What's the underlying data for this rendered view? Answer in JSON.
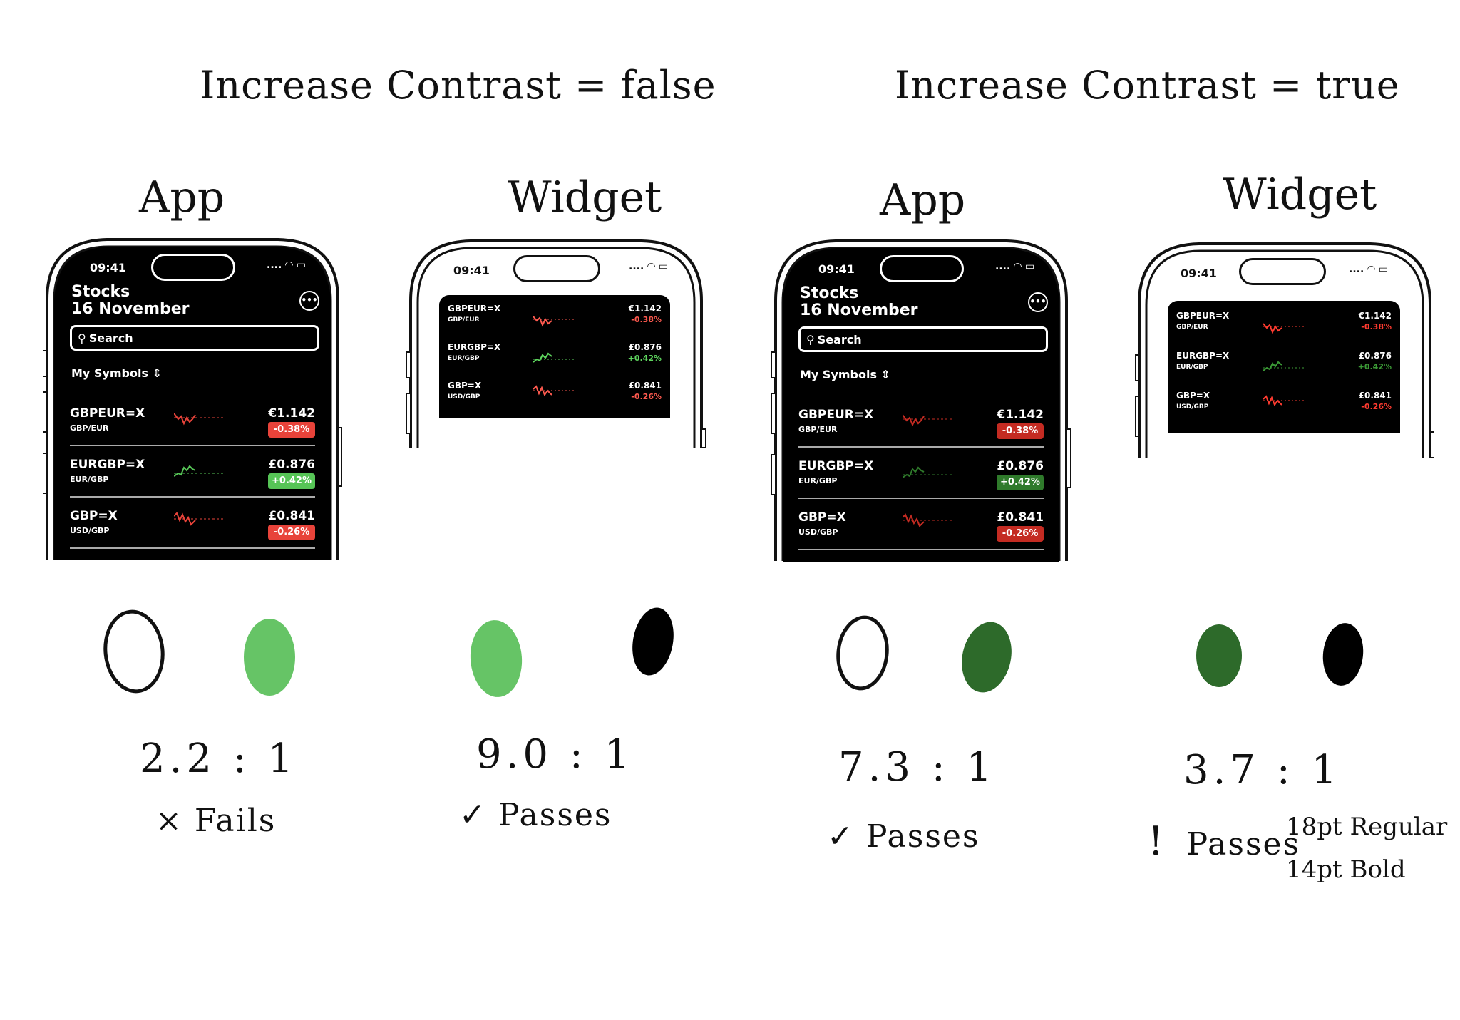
{
  "headings": {
    "left": "Increase Contrast = false",
    "right": "Increase Contrast = true"
  },
  "panels": [
    {
      "label": "App",
      "ratio": "2.2 : 1",
      "verdict_mark": "×",
      "verdict": "Fails",
      "swatch_a": "#ffffff",
      "swatch_b": "#66c466"
    },
    {
      "label": "Widget",
      "ratio": "9.0 : 1",
      "verdict_mark": "✓",
      "verdict": "Passes",
      "swatch_a": "#66c466",
      "swatch_b": "#000000"
    },
    {
      "label": "App",
      "ratio": "7.3 : 1",
      "verdict_mark": "✓",
      "verdict": "Passes",
      "swatch_a": "#ffffff",
      "swatch_b": "#2d6a2a"
    },
    {
      "label": "Widget",
      "ratio": "3.7 : 1",
      "verdict_mark": "!",
      "verdict": "Passes",
      "note_line1": "18pt Regular",
      "note_line2": "14pt Bold",
      "swatch_a": "#2d6a2a",
      "swatch_b": "#000000"
    }
  ],
  "phone": {
    "time": "09:41",
    "signal": ".... ",
    "app_title": "Stocks",
    "app_date": "16 November",
    "menu_icon": "•••",
    "search_placeholder": "Search",
    "my_symbols": "My Symbols ⇕",
    "stocks": [
      {
        "symbol": "GBPEUR=X",
        "pair": "GBP/EUR",
        "price": "€1.142",
        "change": "-0.38%",
        "direction": "down"
      },
      {
        "symbol": "EURGBP=X",
        "pair": "EUR/GBP",
        "price": "£0.876",
        "change": "+0.42%",
        "direction": "up"
      },
      {
        "symbol": "GBP=X",
        "pair": "USD/GBP",
        "price": "£0.841",
        "change": "-0.26%",
        "direction": "down"
      }
    ]
  },
  "colors": {
    "red_normal": "#e8433a",
    "green_normal": "#56c456",
    "red_contrast": "#c42b22",
    "green_contrast": "#2f7a2b",
    "widget_red_normal": "#ff5a4f",
    "widget_green_normal": "#5ed65e",
    "widget_red_contrast": "#ff3b30",
    "widget_green_contrast": "#3b9a36"
  }
}
